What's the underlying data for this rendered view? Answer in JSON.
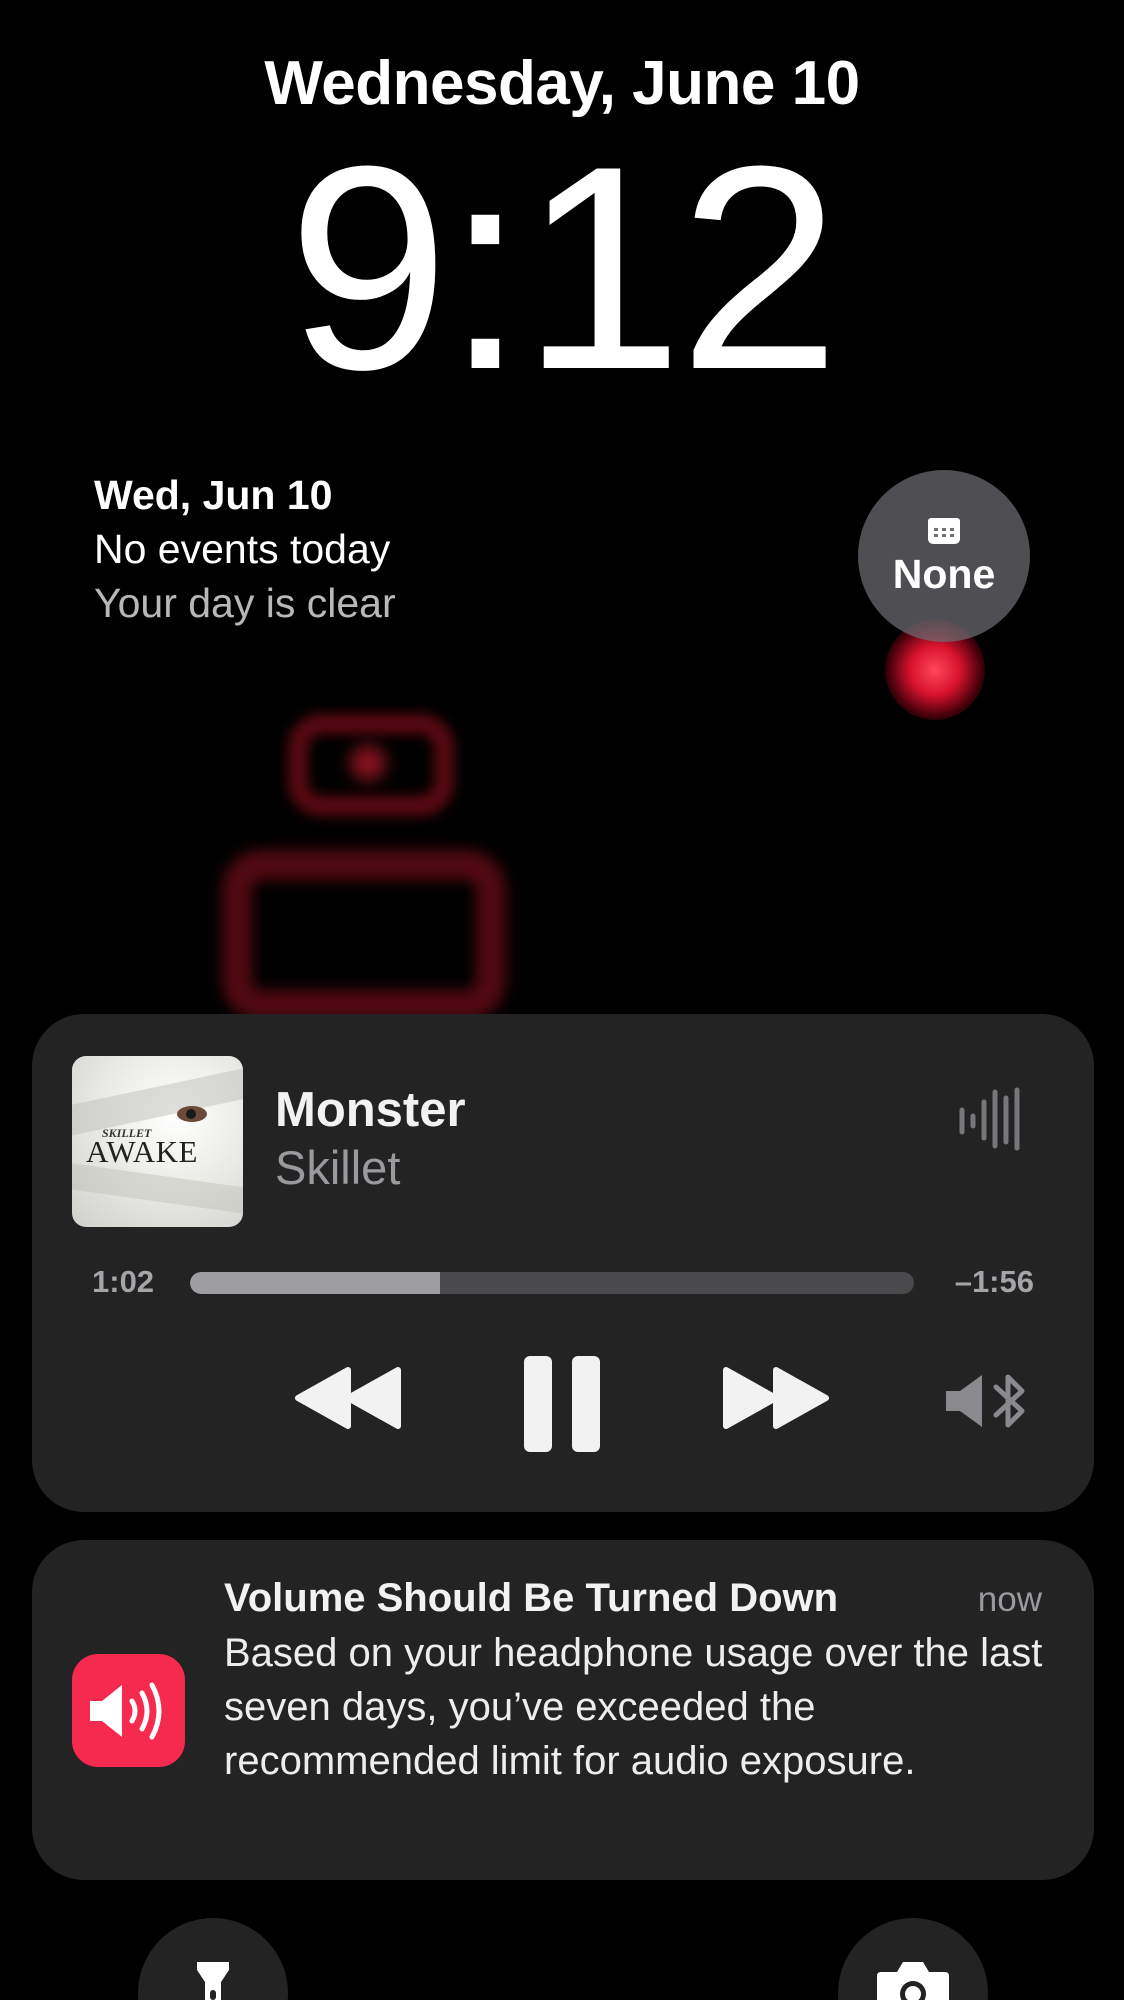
{
  "lockscreen": {
    "date": "Wednesday, June 10",
    "time": "9:12"
  },
  "calendar_widget": {
    "date": "Wed, Jun 10",
    "events": "No events today",
    "status": "Your day is clear"
  },
  "next_event_widget": {
    "icon": "calendar-icon",
    "label": "None"
  },
  "now_playing": {
    "album_art": {
      "band_text": "SKILLET",
      "album_text": "AWAKE"
    },
    "title": "Monster",
    "artist": "Skillet",
    "elapsed": "1:02",
    "remaining": "–1:56",
    "progress": 0.345,
    "icons": [
      "waveform-icon",
      "rewind-icon",
      "pause-icon",
      "fast-forward-icon",
      "bluetooth-audio-output-icon"
    ]
  },
  "notification": {
    "title": "Volume Should Be Turned Down",
    "time": "now",
    "body": "Based on your headphone usage over the last seven days, you’ve exceeded the recommended limit for audio exposure.",
    "icon": "speaker-loud-icon",
    "icon_color": "#f6294f"
  },
  "quick_actions": [
    "flashlight-icon",
    "camera-icon"
  ]
}
